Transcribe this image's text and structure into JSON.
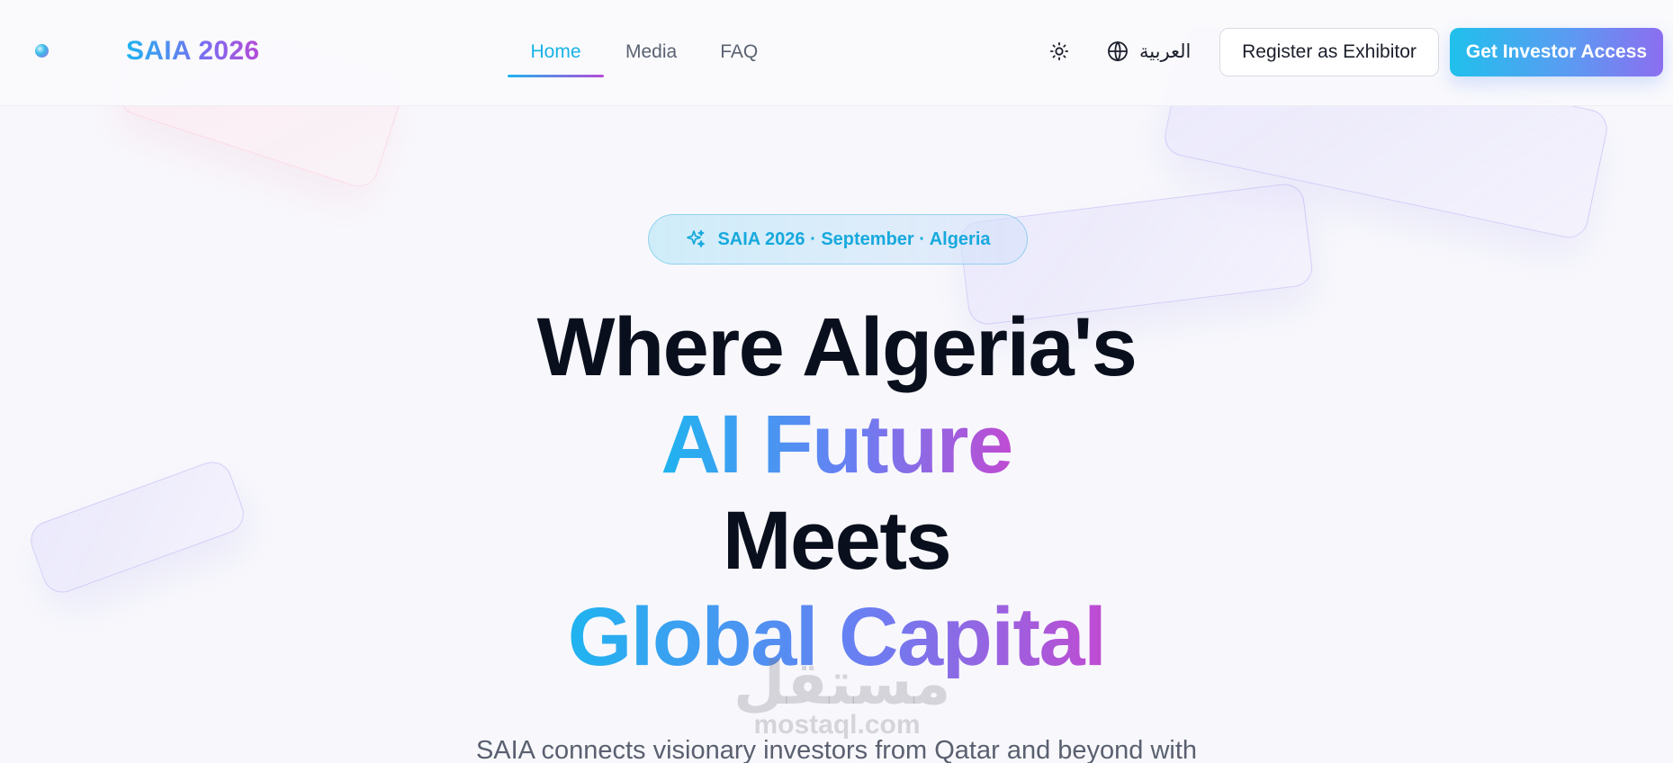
{
  "header": {
    "brand": "SAIA 2026",
    "nav": [
      {
        "label": "Home",
        "active": true
      },
      {
        "label": "Media",
        "active": false
      },
      {
        "label": "FAQ",
        "active": false
      }
    ],
    "theme_icon": "sun-icon",
    "language": {
      "icon": "globe-icon",
      "label": "العربية"
    },
    "register_button": "Register as Exhibitor",
    "investor_button": "Get Investor Access"
  },
  "hero": {
    "badge": {
      "icon": "sparkles-icon",
      "text": "SAIA 2026 · September · Algeria"
    },
    "line1": "Where Algeria's",
    "line2": "AI Future",
    "line3": "Meets",
    "line4": "Global Capital",
    "subtitle": "SAIA connects visionary investors from Qatar and beyond with"
  },
  "watermark": {
    "arabic": "مستقل",
    "latin": "mostaql.com"
  },
  "colors": {
    "accent_cyan": "#1fb4f0",
    "accent_purple": "#8c6ef0",
    "accent_magenta": "#c04bd2",
    "heading": "#0a0f1e"
  }
}
